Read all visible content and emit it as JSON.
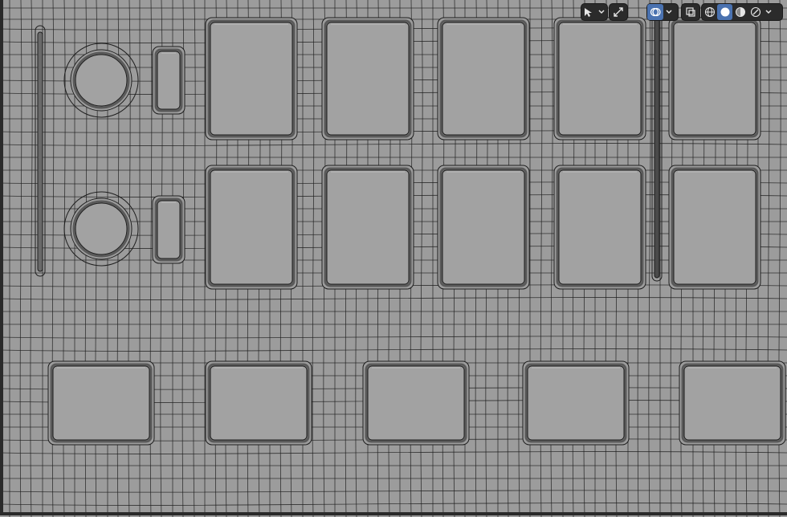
{
  "viewport": {
    "background": "#9c9c9c",
    "wire_color": "#1e1e1e",
    "frame_color": "#2a2a2a",
    "key_fill": "#a2a2a2",
    "key_highlight": "#b4b4b4",
    "key_shadow": "#5a5a5a"
  },
  "header_tools": [
    {
      "name": "select-box-tool",
      "icon": "cursor-select-icon",
      "has_dropdown": true
    },
    {
      "name": "transform-gizmo",
      "icon": "gizmo-icon",
      "has_dropdown": false
    },
    {
      "name": "overlays-toggle",
      "icon": "overlays-icon",
      "has_dropdown": true,
      "active": true
    },
    {
      "name": "xray-toggle",
      "icon": "xray-icon",
      "has_dropdown": false
    },
    {
      "name": "shading-wireframe",
      "icon": "wireframe-sphere-icon"
    },
    {
      "name": "shading-solid",
      "icon": "solid-sphere-icon",
      "active": true
    },
    {
      "name": "shading-material",
      "icon": "material-sphere-icon"
    },
    {
      "name": "shading-rendered",
      "icon": "rendered-sphere-icon"
    },
    {
      "name": "shading-options",
      "icon": "chevron-down-icon"
    }
  ],
  "accent": "#4a72b0"
}
